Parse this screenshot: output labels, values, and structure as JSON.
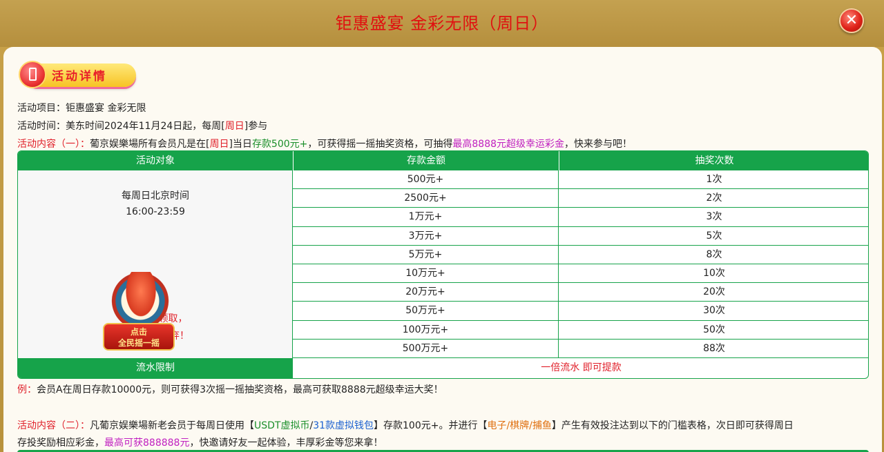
{
  "header": {
    "title": "钜惠盛宴 金彩无限（周日）"
  },
  "badge": {
    "label": "活动详情"
  },
  "info": {
    "project_label": "活动项目：",
    "project_value": "钜惠盛宴 金彩无限",
    "time_label": "活动时间：",
    "time_pre": "美东时间2024年11月24日起，每周[",
    "time_day": "周日",
    "time_post": "]参与"
  },
  "content1": {
    "label": "活动内容（一）：",
    "t1": "葡京娱樂場所有会员凡是在[",
    "day": "周日",
    "t2": "]当日",
    "deposit": "存款500元+",
    "t3": "，可获得摇一摇抽奖资格，可抽得",
    "prize": "最高8888元超级幸运彩金",
    "t4": "，快来参与吧！"
  },
  "table": {
    "headers": [
      "活动对象",
      "存款金额",
      "抽奖次数"
    ],
    "target_line1": "每周日北京时间",
    "target_line2": "16:00-23:59",
    "promo_line1": "点击",
    "promo_line2": "全民摇一摇",
    "expire_line1": "限时1天领取，",
    "expire_line2": "逾期视为放弃！",
    "rows": [
      {
        "amount": "500元+",
        "draws": "1次"
      },
      {
        "amount": "2500元+",
        "draws": "2次"
      },
      {
        "amount": "1万元+",
        "draws": "3次"
      },
      {
        "amount": "3万元+",
        "draws": "5次"
      },
      {
        "amount": "5万元+",
        "draws": "8次"
      },
      {
        "amount": "10万元+",
        "draws": "10次"
      },
      {
        "amount": "20万元+",
        "draws": "20次"
      },
      {
        "amount": "50万元+",
        "draws": "30次"
      },
      {
        "amount": "100万元+",
        "draws": "50次"
      },
      {
        "amount": "500万元+",
        "draws": "88次"
      }
    ],
    "footer_label": "流水限制",
    "footer_value": "一倍流水 即可提款"
  },
  "example": {
    "label": "例：",
    "text": "会员A在周日存款10000元，则可获得3次摇一摇抽奖资格，最高可获取8888元超级幸运大奖！"
  },
  "content2": {
    "label": "活动内容（二）：",
    "t1": "凡葡京娱樂場新老会员于每周日使用【",
    "usdt": "USDT虚拟币",
    "slash": "/",
    "wallet": "31款虚拟钱包",
    "t2": "】存款100元+。并进行【",
    "games": "电子/棋牌/捕鱼",
    "t3": "】产生有效投注达到以下的门槛表格，次日即可获得周日",
    "t4": "存投奖励相应彩金，",
    "max": "最高可获888888元",
    "t5": "，快邀请好友一起体验，丰厚彩金等您来拿！"
  },
  "colors": {
    "accent_green": "#16a34a",
    "title_red": "#e01010",
    "header_gold": "#c4a150"
  },
  "icons": {
    "close": "close-icon",
    "badge": "phone-icon"
  }
}
